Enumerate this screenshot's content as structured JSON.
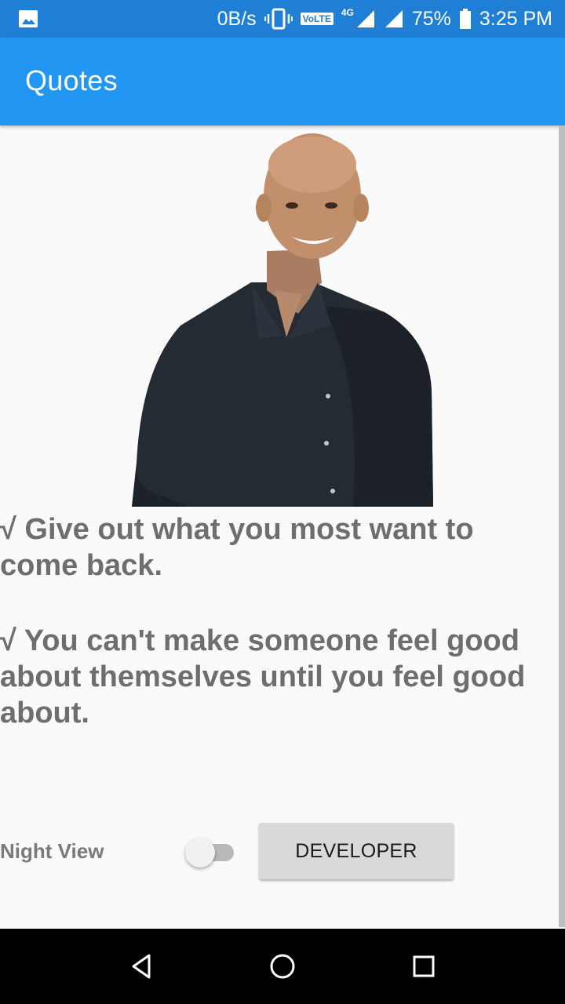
{
  "status_bar": {
    "speed": "0B/s",
    "volte": "VoLTE",
    "network": "4G",
    "battery": "75%",
    "time": "3:25 PM"
  },
  "app_bar": {
    "title": "Quotes"
  },
  "quotes": [
    "√ Give out what you most want to come back.",
    "√ You can't make someone feel good about themselves until you feel good about."
  ],
  "settings": {
    "night_view_label": "Night View",
    "night_view_enabled": false,
    "developer_button": "DEVELOPER"
  },
  "colors": {
    "status_bar": "#1f7fd4",
    "app_bar": "#2196f3",
    "quote_text": "#6e6e6e"
  },
  "icons": [
    "image-icon",
    "vibrate-icon",
    "signal-icon",
    "battery-icon",
    "back-icon",
    "home-icon",
    "recents-icon"
  ]
}
